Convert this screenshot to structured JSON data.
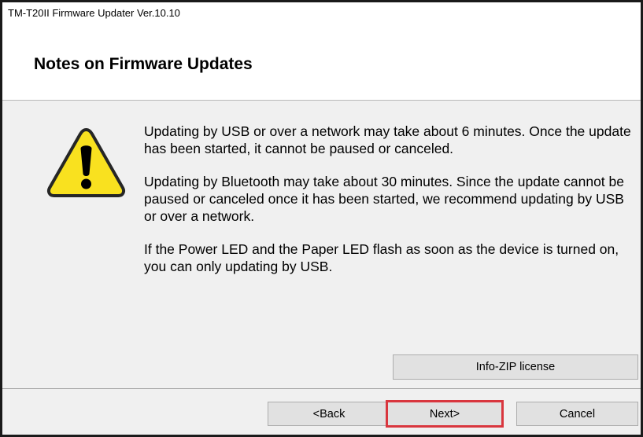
{
  "window": {
    "title": "TM-T20II Firmware Updater Ver.10.10"
  },
  "header": {
    "title": "Notes on Firmware Updates"
  },
  "main": {
    "warning_icon": "warning-triangle-icon",
    "notes": [
      "Updating by USB or over a network may take about 6 minutes. Once the update has been started, it cannot be paused or canceled.",
      "Updating by Bluetooth may take about 30 minutes. Since the update cannot be paused or canceled once it has been started, we recommend updating by USB or over a network.",
      "If the Power LED and the Paper LED flash as soon as the device is turned on, you can only updating by USB."
    ],
    "info_zip_label": "Info-ZIP license"
  },
  "footer": {
    "back_label": "<Back",
    "next_label": "Next>",
    "cancel_label": "Cancel"
  },
  "colors": {
    "warning_fill": "#f9e11f",
    "warning_stroke": "#262626",
    "next_highlight": "#d9363e"
  }
}
